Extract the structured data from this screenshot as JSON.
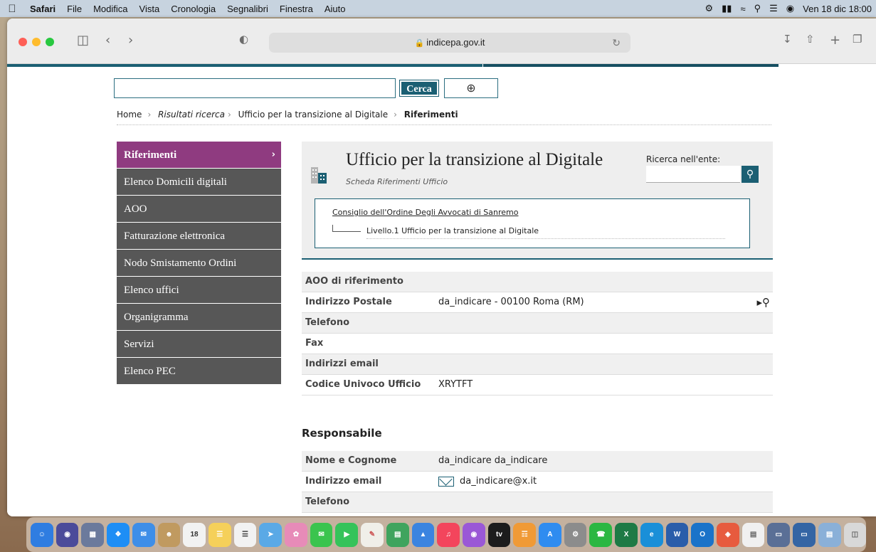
{
  "menubar": {
    "app": "Safari",
    "items": [
      "File",
      "Modifica",
      "Vista",
      "Cronologia",
      "Segnalibri",
      "Finestra",
      "Aiuto"
    ],
    "clock": "Ven 18 dic  18:00"
  },
  "browser": {
    "url": "indicepa.gov.it"
  },
  "search": {
    "button_label": "Cerca",
    "value": ""
  },
  "breadcrumb": {
    "home": "Home",
    "results": "Risultati ricerca",
    "office": "Ufficio per la transizione al Digitale",
    "current": "Riferimenti"
  },
  "sidebar": {
    "items": [
      {
        "label": "Riferimenti",
        "active": true
      },
      {
        "label": "Elenco Domicili digitali"
      },
      {
        "label": "AOO"
      },
      {
        "label": "Fatturazione elettronica"
      },
      {
        "label": "Nodo Smistamento Ordini"
      },
      {
        "label": "Elenco uffici"
      },
      {
        "label": "Organigramma"
      },
      {
        "label": "Servizi"
      },
      {
        "label": "Elenco PEC"
      }
    ]
  },
  "header": {
    "title": "Ufficio per la transizione al Digitale",
    "subtitle": "Scheda Riferimenti Ufficio",
    "search_label": "Ricerca nell'ente:",
    "parent": "Consiglio dell'Ordine Degli Avvocati di Sanremo",
    "child": "Livello.1 Ufficio per la transizione al Digitale"
  },
  "details": [
    {
      "key": "AOO di riferimento",
      "value": ""
    },
    {
      "key": "Indirizzo Postale",
      "value": "da_indicare - 00100 Roma (RM)"
    },
    {
      "key": "Telefono",
      "value": ""
    },
    {
      "key": "Fax",
      "value": ""
    },
    {
      "key": "Indirizzi email",
      "value": ""
    },
    {
      "key": "Codice Univoco Ufficio",
      "value": "XRYTFT"
    }
  ],
  "responsabile": {
    "heading": "Responsabile",
    "rows": [
      {
        "key": "Nome e Cognome",
        "value": "da_indicare da_indicare"
      },
      {
        "key": "Indirizzo email",
        "value": "da_indicare@x.it"
      },
      {
        "key": "Telefono",
        "value": ""
      }
    ]
  },
  "colors": {
    "teal": "#1b5f73",
    "active": "#8f3b80",
    "sidebar": "#575757"
  }
}
